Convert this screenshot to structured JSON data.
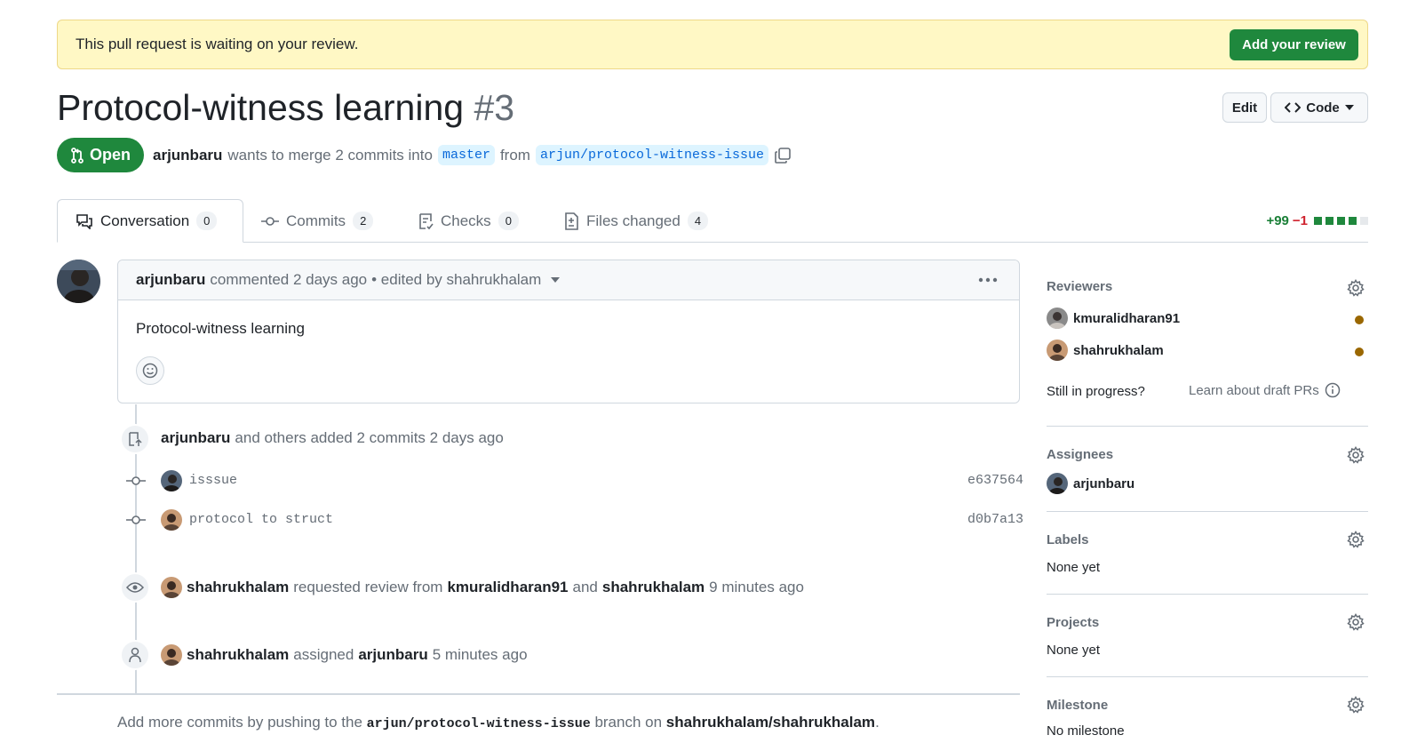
{
  "banner": {
    "text": "This pull request is waiting on your review.",
    "button": "Add your review"
  },
  "pr": {
    "title": "Protocol-witness learning",
    "number": "#3",
    "state": "Open",
    "author": "arjunbaru",
    "merge_text": "wants to merge 2 commits into",
    "base_branch": "master",
    "from_text": "from",
    "head_branch": "arjun/protocol-witness-issue"
  },
  "header_buttons": {
    "edit": "Edit",
    "code": "Code"
  },
  "tabs": [
    {
      "label": "Conversation",
      "count": "0"
    },
    {
      "label": "Commits",
      "count": "2"
    },
    {
      "label": "Checks",
      "count": "0"
    },
    {
      "label": "Files changed",
      "count": "4"
    }
  ],
  "diffstat": {
    "additions": "+99",
    "deletions": "−1"
  },
  "comment": {
    "author": "arjunbaru",
    "action": "commented 2 days ago",
    "edited": "• edited by shahrukhalam",
    "body": "Protocol-witness learning"
  },
  "timeline": {
    "commits_event": {
      "actor": "arjunbaru",
      "text": "and others added 2 commits 2 days ago"
    },
    "commits": [
      {
        "message": "isssue",
        "sha": "e637564"
      },
      {
        "message": "protocol to struct",
        "sha": "d0b7a13"
      }
    ],
    "review_event": {
      "actor": "shahrukhalam",
      "text1": "requested review from",
      "user1": "kmuralidharan91",
      "and": "and",
      "user2": "shahrukhalam",
      "time": "9 minutes ago"
    },
    "assign_event": {
      "actor": "shahrukhalam",
      "text": "assigned",
      "user": "arjunbaru",
      "time": "5 minutes ago"
    }
  },
  "footer": {
    "prefix": "Add more commits by pushing to the",
    "branch": "arjun/protocol-witness-issue",
    "middle": "branch on",
    "repo": "shahrukhalam/shahrukhalam",
    "suffix": "."
  },
  "sidebar": {
    "reviewers_heading": "Reviewers",
    "reviewers": [
      "kmuralidharan91",
      "shahrukhalam"
    ],
    "draft_prompt": "Still in progress?",
    "draft_link": "Learn about draft PRs",
    "assignees_heading": "Assignees",
    "assignee": "arjunbaru",
    "labels_heading": "Labels",
    "labels_value": "None yet",
    "projects_heading": "Projects",
    "projects_value": "None yet",
    "milestone_heading": "Milestone",
    "milestone_value": "No milestone"
  },
  "colors": {
    "green": "#1f883d",
    "banner_bg": "#fff8c5",
    "pending_dot": "#9a6700",
    "branch_blue": "#0969da"
  }
}
